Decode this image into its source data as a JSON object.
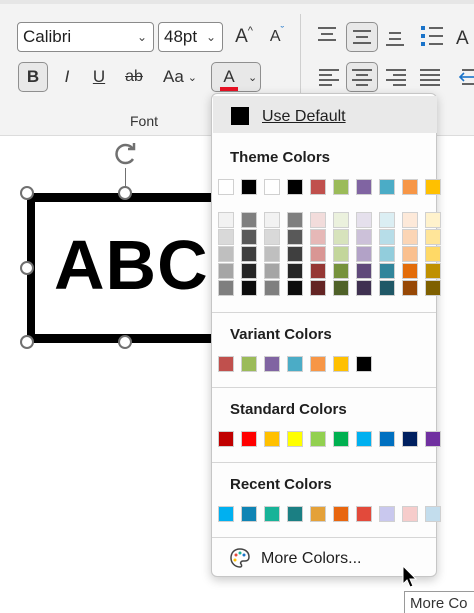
{
  "ribbon": {
    "font_name": "Calibri",
    "font_size": "48pt",
    "group_label": "Font",
    "grow_font_label": "A",
    "shrink_font_label": "A",
    "bold_label": "B",
    "italic_label": "I",
    "underline_label": "U",
    "strikethrough_label": "ab",
    "change_case_label": "Aa",
    "font_color_label": "A",
    "font_color_accent": "#e81123",
    "edge_label": "A"
  },
  "canvas": {
    "text": "ABC"
  },
  "color_menu": {
    "use_default_label": "Use Default",
    "theme_title": "Theme Colors",
    "theme_top": [
      "#ffffff",
      "#000000",
      "#ffffff",
      "#000000",
      "#c0504d",
      "#9bbb59",
      "#8064a2",
      "#4bacc6",
      "#f79646",
      "#ffc000"
    ],
    "theme_shades": [
      [
        "#f2f2f2",
        "#7f7f7f",
        "#f2f2f2",
        "#7f7f7f",
        "#f2dcdb",
        "#ebf1dd",
        "#e5e0ec",
        "#dbeef3",
        "#fde9d9",
        "#fff2cc"
      ],
      [
        "#d9d9d9",
        "#595959",
        "#d9d9d9",
        "#595959",
        "#e6b8b7",
        "#d7e3bc",
        "#ccc1d9",
        "#b7dde8",
        "#fbd5b5",
        "#ffe599"
      ],
      [
        "#bfbfbf",
        "#3f3f3f",
        "#bfbfbf",
        "#3f3f3f",
        "#d99694",
        "#c3d69b",
        "#b2a2c7",
        "#92cddc",
        "#fac08f",
        "#ffd966"
      ],
      [
        "#a5a5a5",
        "#262626",
        "#a5a5a5",
        "#262626",
        "#953734",
        "#76923c",
        "#5f497a",
        "#31859b",
        "#e36c09",
        "#bf9000"
      ],
      [
        "#7f7f7f",
        "#0c0c0c",
        "#7f7f7f",
        "#0c0c0c",
        "#632423",
        "#4f6128",
        "#3f3151",
        "#205867",
        "#974806",
        "#7f6000"
      ]
    ],
    "variant_title": "Variant Colors",
    "variant": [
      "#c0504d",
      "#9bbb59",
      "#8064a2",
      "#4bacc6",
      "#f79646",
      "#ffc000",
      "#000000"
    ],
    "standard_title": "Standard Colors",
    "standard": [
      "#c00000",
      "#ff0000",
      "#ffc000",
      "#ffff00",
      "#92d050",
      "#00b050",
      "#00b0f0",
      "#0070c0",
      "#002060",
      "#7030a0"
    ],
    "recent_title": "Recent Colors",
    "recent": [
      "#00b0f0",
      "#0f84b4",
      "#18b398",
      "#1b7f83",
      "#e4a139",
      "#e8660f",
      "#e24a3b",
      "#c9c8ee",
      "#f6cccb",
      "#c3dded"
    ],
    "more_colors_label": "More Colors..."
  },
  "tooltip": {
    "text": "More Co"
  }
}
